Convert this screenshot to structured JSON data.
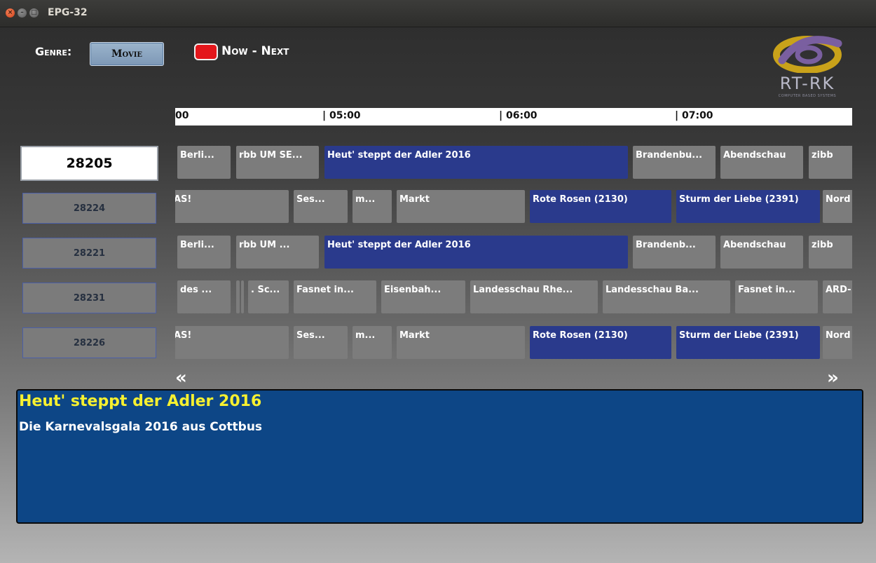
{
  "window": {
    "title": "EPG-32"
  },
  "header": {
    "genre_label": "Genre:",
    "genre_value": "Movie",
    "now_next_label": "Now - Next"
  },
  "logo": {
    "text": "RT-RK",
    "tagline": "COMPUTER BASED SYSTEMS"
  },
  "timeline": {
    "ticks": [
      "00",
      "| 05:00",
      "| 06:00",
      "| 07:00"
    ]
  },
  "channels": [
    {
      "number": "28205",
      "selected": true
    },
    {
      "number": "28224",
      "selected": false
    },
    {
      "number": "28221",
      "selected": false
    },
    {
      "number": "28231",
      "selected": false
    },
    {
      "number": "28226",
      "selected": false
    }
  ],
  "programs": [
    [
      "Berli...",
      "rbb UM SE...",
      "Heut' steppt der Adler 2016",
      "Brandenbu...",
      "Abendschau",
      "zibb"
    ],
    [
      "AS!",
      "Ses...",
      "m...",
      "Markt",
      "Rote Rosen (2130)",
      "Sturm der Liebe (2391)",
      "Nord"
    ],
    [
      "Berli...",
      "rbb UM ...",
      "Heut' steppt der Adler 2016",
      "Brandenb...",
      "Abendschau",
      "zibb"
    ],
    [
      "des ...",
      "",
      ". Sc...",
      "Fasnet in...",
      "Eisenbah...",
      "Landesschau Rhe...",
      "Landesschau Ba...",
      "Fasnet in...",
      "ARD-"
    ],
    [
      "AS!",
      "Ses...",
      "m...",
      "Markt",
      "Rote Rosen (2130)",
      "Sturm der Liebe (2391)",
      "Nord"
    ]
  ],
  "nav": {
    "prev": "«",
    "next": "»"
  },
  "details": {
    "title": "Heut' steppt der Adler 2016",
    "description": "Die Karnevalsgala 2016 aus Cottbus"
  },
  "colors": {
    "program": "#7c7c7c",
    "program_highlight": "#2a3a8c",
    "info_background": "#0d4686",
    "info_title": "#f6f030",
    "red_key": "#e4161b"
  }
}
